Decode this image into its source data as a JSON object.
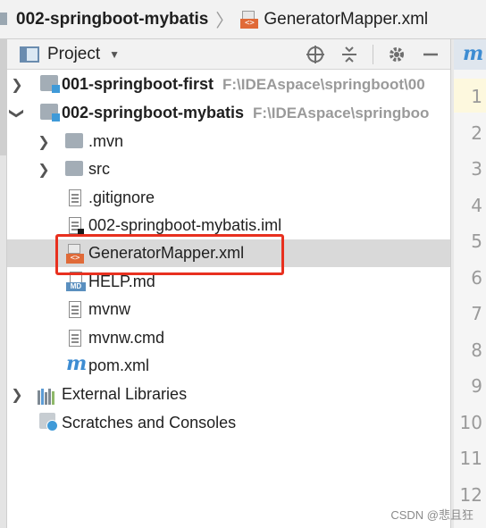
{
  "breadcrumb": {
    "project": "002-springboot-mybatis",
    "separator": "〉",
    "file": "GeneratorMapper.xml"
  },
  "toolbar": {
    "title": "Project",
    "icons": [
      "locate-icon",
      "collapse-all-icon",
      "gear-icon",
      "minimize-icon"
    ]
  },
  "tree": {
    "items": [
      {
        "label": "001-springboot-first",
        "path": "F:\\IDEAspace\\springboot\\00",
        "icon": "module-folder-icon",
        "expanded": false
      },
      {
        "label": "002-springboot-mybatis",
        "path": "F:\\IDEAspace\\springboo",
        "icon": "module-folder-icon",
        "expanded": true
      },
      {
        "label": ".mvn",
        "icon": "folder-icon",
        "expanded": false
      },
      {
        "label": "src",
        "icon": "folder-icon",
        "expanded": false
      },
      {
        "label": ".gitignore",
        "icon": "text-file-icon"
      },
      {
        "label": "002-springboot-mybatis.iml",
        "icon": "iml-file-icon"
      },
      {
        "label": "GeneratorMapper.xml",
        "icon": "xml-file-icon",
        "selected": true
      },
      {
        "label": "HELP.md",
        "icon": "markdown-file-icon",
        "badge": "MD"
      },
      {
        "label": "mvnw",
        "icon": "text-file-icon"
      },
      {
        "label": "mvnw.cmd",
        "icon": "text-file-icon"
      },
      {
        "label": "pom.xml",
        "icon": "maven-icon",
        "glyph": "m"
      },
      {
        "label": "External Libraries",
        "icon": "library-icon",
        "expanded": false
      },
      {
        "label": "Scratches and Consoles",
        "icon": "scratch-icon"
      }
    ]
  },
  "editor": {
    "tab_glyph": "m",
    "line_numbers": [
      "1",
      "2",
      "3",
      "4",
      "5",
      "6",
      "7",
      "8",
      "9",
      "10",
      "11",
      "12"
    ]
  },
  "watermark": "CSDN @悲且狂",
  "colors": {
    "highlight_box": "#e8301f",
    "selection": "#d9d9d9",
    "module_badge": "#3f9ad8",
    "xml_badge": "#e06a38"
  }
}
